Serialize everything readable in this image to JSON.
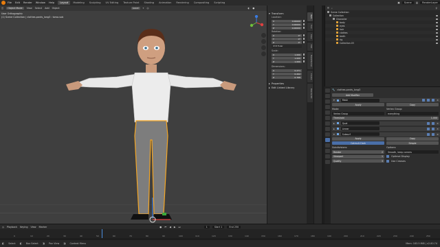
{
  "topbar": {
    "menus": [
      "File",
      "Edit",
      "Render",
      "Window",
      "Help"
    ],
    "tabs": [
      "Layout",
      "Modeling",
      "Sculpting",
      "UV Editing",
      "Texture Paint",
      "Shading",
      "Animation",
      "Rendering",
      "Compositing",
      "Scripting"
    ],
    "active_tab": "Layout",
    "scene": "Scene",
    "view_layer": "RenderLayer"
  },
  "viewport": {
    "mode": "Object Mode",
    "menus": [
      "View",
      "Select",
      "Add",
      "Object"
    ],
    "orientation": "Local",
    "info_line1": "User Orthographic",
    "info_line2": "(1) Scene Collection | clothes.pants_long3 : torso.sub",
    "gizmo": {
      "x": "X",
      "y": "Y",
      "z": "Z"
    }
  },
  "npanel": {
    "section": "Transform",
    "location_label": "Location:",
    "location": [
      {
        "axis": "X",
        "val": "0.00000"
      },
      {
        "axis": "Y",
        "val": "0.00000"
      },
      {
        "axis": "Z",
        "val": "0.00000"
      }
    ],
    "rotation_label": "Rotation:",
    "rotation": [
      {
        "axis": "X",
        "val": "0°"
      },
      {
        "axis": "Y",
        "val": "0°"
      },
      {
        "axis": "Z",
        "val": "0°"
      }
    ],
    "rotation_mode": "XYZ Euler",
    "scale_label": "Scale:",
    "scale": [
      {
        "axis": "X",
        "val": "1.000"
      },
      {
        "axis": "Y",
        "val": "1.000"
      },
      {
        "axis": "Z",
        "val": "1.000"
      }
    ],
    "dimensions_label": "Dimensions:",
    "dimensions": [
      {
        "axis": "X",
        "val": "0.271"
      },
      {
        "axis": "Y",
        "val": "0.202"
      },
      {
        "axis": "Z",
        "val": "0.768"
      }
    ],
    "properties_label": "Properties",
    "edit_library_label": "Edit Linked Library",
    "tabs": [
      "Item",
      "Tool",
      "View",
      "Edit",
      "MakeHuman",
      "Create",
      "BlenderKit"
    ]
  },
  "outliner": {
    "header": "Scene Collection",
    "rows": [
      {
        "label": "Collection",
        "indent": 0
      },
      {
        "label": "Character",
        "indent": 1
      },
      {
        "label": "body",
        "indent": 2
      },
      {
        "label": "eyes",
        "indent": 2
      },
      {
        "label": "hair",
        "indent": 2
      },
      {
        "label": "clothes",
        "indent": 2
      },
      {
        "label": "teeth",
        "indent": 2
      },
      {
        "label": "rig",
        "indent": 2
      },
      {
        "label": "Collection.03",
        "indent": 2
      }
    ]
  },
  "properties": {
    "object_name": "clothes.pants_long3",
    "add_modifier": "Add Modifier",
    "mask": {
      "name": "Mask",
      "apply": "Apply",
      "copy": "Copy",
      "mode_label": "Mode:",
      "mode": "Vertex Group",
      "group_label": "Vertex Group:",
      "group": "everything",
      "threshold_label": "Threshold",
      "threshold": "1.000"
    },
    "modifiers": [
      "Quat",
      "Linear",
      "Subsurf"
    ],
    "subsurf": {
      "apply": "Apply",
      "copy": "Copy",
      "catmull": "Catmull-Clark",
      "simple": "Simple",
      "subdivisions": "Subdivisions:",
      "render": "Render",
      "render_val": "2",
      "viewport": "Viewport",
      "viewport_val": "1",
      "quality": "Quality",
      "quality_val": "3",
      "options": "Options:",
      "smooth": "Smooth, keep corners",
      "optimal": "Optimal Display",
      "use_creases": "Use Creases"
    }
  },
  "timeline": {
    "menus": [
      "Playback",
      "Keying",
      "View",
      "Marker"
    ],
    "current_frame": "1",
    "start_label": "Start",
    "start": "1",
    "end_label": "End",
    "end": "250",
    "ticks": [
      "0",
      "10",
      "20",
      "30",
      "40",
      "50",
      "60",
      "70",
      "80",
      "90",
      "100",
      "110",
      "120",
      "130",
      "140",
      "150",
      "160",
      "170",
      "180",
      "190",
      "200",
      "210",
      "220",
      "230",
      "240",
      "250"
    ]
  },
  "status": {
    "items": [
      "Select",
      "Box Select",
      "Pan View",
      "Context Menu"
    ],
    "right": "Mem: 183.5 MiB | v2.80.74"
  },
  "colors": {
    "accent": "#e87d0d",
    "selection": "#f5a623",
    "active_tab": "#4a6fa8"
  }
}
